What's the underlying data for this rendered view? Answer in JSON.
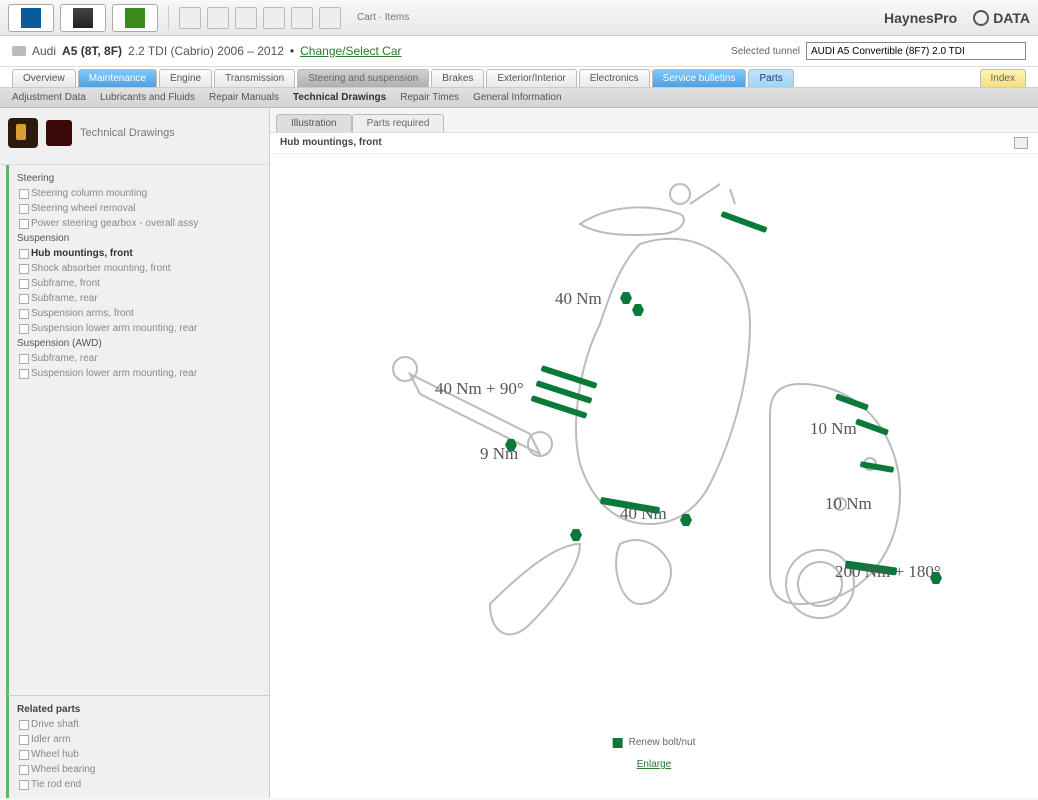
{
  "toolbar": {
    "user_label": "Cart · Items",
    "brand1": "HaynesPro",
    "brand2": "DATA"
  },
  "vehicle": {
    "prefix": "Audi",
    "model": "A5 (8T, 8F)",
    "variant": "2.2 TDI (Cabrio) 2006 – 2012",
    "link": "Change/Select Car",
    "tunnel_label": "Selected tunnel",
    "tunnel_value": "AUDI A5 Convertible (8F7) 2.0 TDI"
  },
  "tabs": {
    "items": [
      "Overview",
      "Maintenance",
      "Engine",
      "Transmission",
      "Steering and suspension",
      "Brakes",
      "Exterior/Interior",
      "Electronics",
      "Service bulletins",
      "Parts"
    ],
    "index": "Index"
  },
  "subtabs": {
    "items": [
      "Adjustment Data",
      "Lubricants and Fluids",
      "Repair Manuals",
      "Technical Drawings",
      "Repair Times",
      "General Information"
    ],
    "active_idx": 3
  },
  "side": {
    "title": "Technical Drawings",
    "tree": [
      {
        "label": "Steering",
        "children": [
          "Steering column mounting",
          "Steering wheel removal",
          "Power steering gearbox - overall assy"
        ]
      },
      {
        "label": "Suspension",
        "children": [
          "Hub mountings, front",
          "Shock absorber mounting, front",
          "Subframe, front",
          "Subframe, rear",
          "Suspension arms, front",
          "Suspension lower arm mounting, rear"
        ],
        "active_child_idx": 0
      },
      {
        "label": "Suspension (AWD)",
        "children": [
          "Subframe, rear",
          "Suspension lower arm mounting, rear"
        ]
      }
    ],
    "related_head": "Related parts",
    "related": [
      "Drive shaft",
      "Idler arm",
      "Wheel hub",
      "Wheel bearing",
      "Tie rod end"
    ]
  },
  "content": {
    "tabs": [
      "Illustration",
      "Parts required"
    ],
    "title": "Hub mountings, front",
    "torques": {
      "t1": "40 Nm",
      "t2": "40 Nm + 90°",
      "t3": "9 Nm",
      "t4": "10 Nm",
      "t5": "40 Nm",
      "t6": "10 Nm",
      "t7": "200 Nm + 180°"
    },
    "legend": "Renew bolt/nut",
    "link": "Enlarge"
  }
}
